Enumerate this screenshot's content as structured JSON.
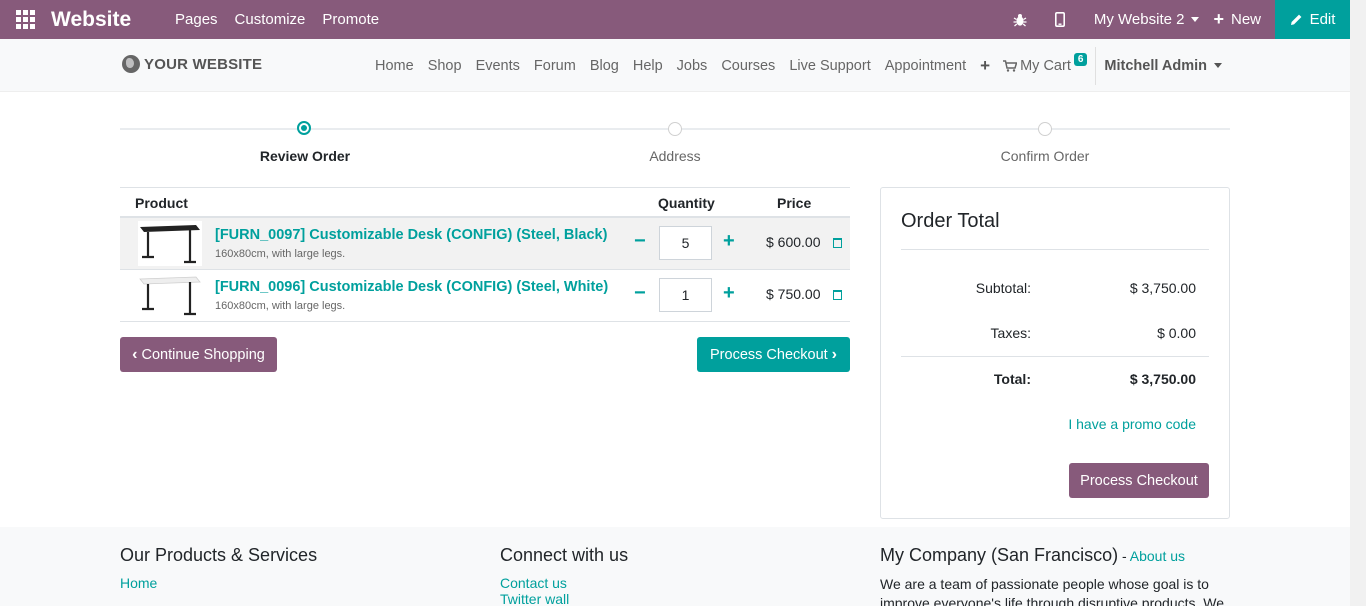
{
  "admin_bar": {
    "brand": "Website",
    "menu": [
      "Pages",
      "Customize",
      "Promote"
    ],
    "website_switcher": "My Website 2",
    "new_label": "New",
    "edit_label": "Edit",
    "icons": [
      "apps-grid-icon",
      "bug-icon",
      "mobile-icon",
      "plus-icon",
      "pencil-icon"
    ]
  },
  "site_nav": {
    "logo_text": "YOUR WEBSITE",
    "links": [
      "Home",
      "Shop",
      "Events",
      "Forum",
      "Blog",
      "Help",
      "Jobs",
      "Courses",
      "Live Support",
      "Appointment"
    ],
    "add_symbol": "+",
    "cart_label": "My Cart",
    "cart_count": "6",
    "user_name": "Mitchell Admin"
  },
  "wizard": {
    "steps": [
      "Review Order",
      "Address",
      "Confirm Order"
    ],
    "active_step": 0
  },
  "cart": {
    "headers": {
      "product": "Product",
      "quantity": "Quantity",
      "price": "Price"
    },
    "lines": [
      {
        "name": "[FURN_0097] Customizable Desk (CONFIG) (Steel, Black)",
        "description": "160x80cm, with large legs.",
        "quantity": "5",
        "price": "$ 600.00",
        "desk_color": "#222222"
      },
      {
        "name": "[FURN_0096] Customizable Desk (CONFIG) (Steel, White)",
        "description": "160x80cm, with large legs.",
        "quantity": "1",
        "price": "$ 750.00",
        "desk_color": "#e9e9e9"
      }
    ],
    "minus_symbol": "−",
    "plus_symbol": "+",
    "continue_label": "Continue Shopping",
    "checkout_label": "Process Checkout"
  },
  "order_total": {
    "title": "Order Total",
    "subtotal_label": "Subtotal:",
    "subtotal_value": "$ 3,750.00",
    "taxes_label": "Taxes:",
    "taxes_value": "$ 0.00",
    "total_label": "Total:",
    "total_value": "$ 3,750.00",
    "promo_label": "I have a promo code",
    "checkout_label": "Process Checkout"
  },
  "footer": {
    "col1_title": "Our Products & Services",
    "col1_links": [
      "Home"
    ],
    "col2_title": "Connect with us",
    "col2_links": [
      "Contact us",
      "Twitter wall"
    ],
    "col3_title": "My Company (San Francisco)",
    "col3_separator": " - ",
    "col3_about": "About us",
    "col3_text": "We are a team of passionate people whose goal is to improve everyone's life through disruptive products. We"
  },
  "colors": {
    "brand_purple": "#875a7b",
    "accent_teal": "#00a09d"
  }
}
